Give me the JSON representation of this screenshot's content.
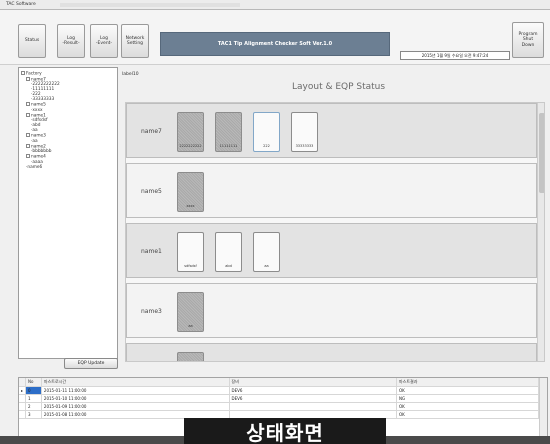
{
  "window": {
    "title": "TAC Software"
  },
  "toolbar": {
    "buttons": [
      {
        "label": "Status"
      },
      {
        "label": "Log\n-Result-"
      },
      {
        "label": "Log\n-Event-"
      },
      {
        "label": "Network\nSetting"
      }
    ],
    "app_title": "TAC1 Tip Alignment Checker Soft Ver.1.0",
    "clock": "2015년 1월 9일 수요일 오전 9:47:24",
    "program_button": "Program\nShut\nDown"
  },
  "tree": {
    "nodes": [
      {
        "text": "Factory",
        "level": 0,
        "expander": true
      },
      {
        "text": "name7",
        "level": 1,
        "expander": true
      },
      {
        "text": "2222222222",
        "level": 2
      },
      {
        "text": "11111111",
        "level": 2
      },
      {
        "text": "222",
        "level": 2
      },
      {
        "text": "33333333",
        "level": 2
      },
      {
        "text": "name5",
        "level": 1,
        "expander": true
      },
      {
        "text": "xxxx",
        "level": 2
      },
      {
        "text": "name1",
        "level": 1,
        "expander": true
      },
      {
        "text": "sdfsdsf",
        "level": 2
      },
      {
        "text": "abd",
        "level": 2
      },
      {
        "text": "aa",
        "level": 2
      },
      {
        "text": "name3",
        "level": 1,
        "expander": true
      },
      {
        "text": "aa",
        "level": 2
      },
      {
        "text": "name2",
        "level": 1,
        "expander": true
      },
      {
        "text": "bbbbbbb",
        "level": 2
      },
      {
        "text": "name4",
        "level": 1,
        "expander": true
      },
      {
        "text": "aaaa",
        "level": 2
      },
      {
        "text": "name6",
        "level": 1
      }
    ]
  },
  "eqp_update_button": "EQP Update",
  "main": {
    "label": "label10",
    "heading": "Layout & EQP Status",
    "rows": [
      {
        "name": "name7",
        "equipment": [
          {
            "label": "2222222222",
            "style": "dark"
          },
          {
            "label": "11111111",
            "style": "dark"
          },
          {
            "label": "222",
            "style": "light-blue"
          },
          {
            "label": "33333333",
            "style": "light"
          }
        ]
      },
      {
        "name": "name5",
        "equipment": [
          {
            "label": "xxxx",
            "style": "dark"
          }
        ]
      },
      {
        "name": "name1",
        "equipment": [
          {
            "label": "sdfsdsf",
            "style": "light"
          },
          {
            "label": "abd",
            "style": "light"
          },
          {
            "label": "aa",
            "style": "light"
          }
        ]
      },
      {
        "name": "name3",
        "equipment": [
          {
            "label": "aa",
            "style": "dark"
          }
        ]
      },
      {
        "name": "",
        "equipment": [
          {
            "label": "",
            "style": "dark"
          }
        ]
      }
    ]
  },
  "log_grid": {
    "columns": [
      "No",
      "마스트로시간",
      "장비",
      "마스트결과"
    ],
    "rows": [
      {
        "no": "0",
        "time": "2015-01-11 11:00:00",
        "eqp": "DEV6",
        "result": "OK",
        "selected": true
      },
      {
        "no": "1",
        "time": "2015-01-10 11:00:00",
        "eqp": "DEV6",
        "result": "NG",
        "selected": false
      },
      {
        "no": "2",
        "time": "2015-01-09 11:00:00",
        "eqp": "",
        "result": "OK",
        "selected": false
      },
      {
        "no": "3",
        "time": "2015-01-08 11:00:00",
        "eqp": "",
        "result": "OK",
        "selected": false
      }
    ]
  },
  "caption": "상태화면"
}
